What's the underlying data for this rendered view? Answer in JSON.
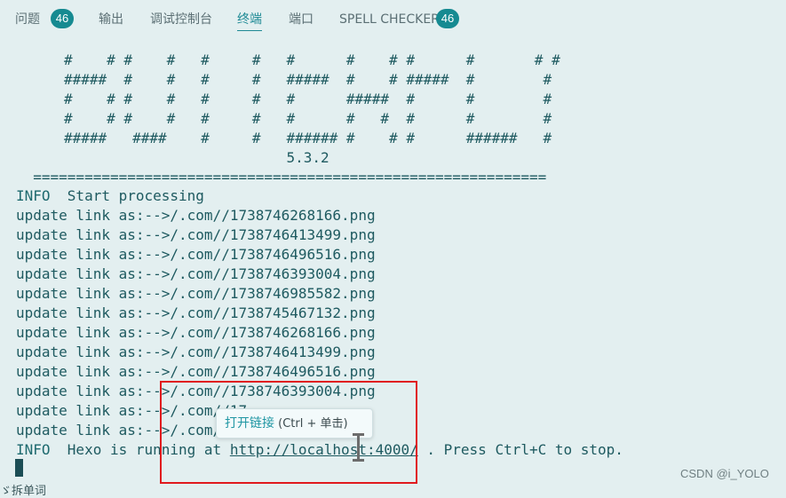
{
  "tabs": [
    {
      "label": "问题",
      "badge": "46",
      "active": false
    },
    {
      "label": "输出",
      "active": false
    },
    {
      "label": "调试控制台",
      "active": false
    },
    {
      "label": "终端",
      "active": true
    },
    {
      "label": "端口",
      "active": false
    },
    {
      "label": "SPELL CHECKER",
      "badge": "46",
      "active": false
    }
  ],
  "terminal": {
    "banner": [
      "#    # #    #   #     #   #      #    # #      #       # #",
      "#####  #    #   #     #   #####  #    # #####  #        #",
      "#    # #    #   #     #   #      #####  #      #        #",
      "#    # #    #   #     #   #      #   #  #      #        #",
      "#####   ####    #     #   ###### #    # #      ######   #",
      "                          5.3.2",
      "  ============================================================"
    ],
    "info_start": {
      "level": "INFO",
      "text": "  Start processing"
    },
    "updates": [
      "update link as:-->/.com//1738746268166.png",
      "update link as:-->/.com//1738746413499.png",
      "update link as:-->/.com//1738746496516.png",
      "update link as:-->/.com//1738746393004.png",
      "update link as:-->/.com//1738746985582.png",
      "update link as:-->/.com//1738745467132.png",
      "update link as:-->/.com//1738746268166.png",
      "update link as:-->/.com//1738746413499.png",
      "update link as:-->/.com//1738746496516.png",
      "update link as:-->/.com//1738746393004.png",
      "update link as:-->/.com//17",
      "update link as:-->/.com//"
    ],
    "info_running": {
      "level": "INFO",
      "prefix": "  Hexo is running at ",
      "link": "http://localhost:4000/",
      "suffix": " . Press Ctrl+C to stop."
    }
  },
  "tooltip": {
    "main": "打开链接",
    "hint": " (Ctrl + 单击)"
  },
  "watermark": "CSDN @i_YOLO",
  "bottom_fragment": "ゞ拆单词",
  "colors": {
    "accent": "#1f8a95",
    "badge": "#168a91",
    "highlight": "#e0191e",
    "background": "#e3eff0"
  }
}
